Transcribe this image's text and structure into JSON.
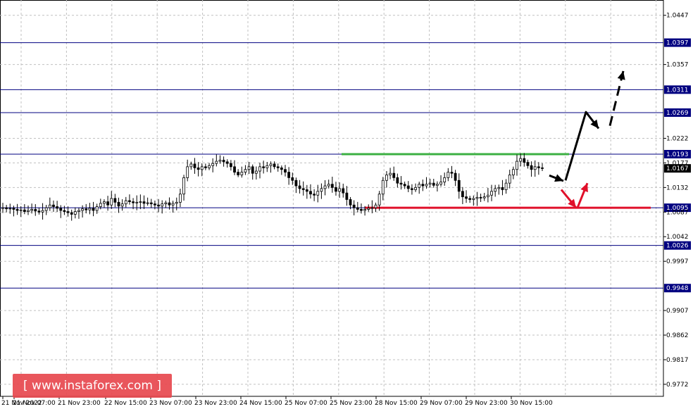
{
  "chart_data": {
    "type": "candlestick",
    "ylim": [
      0.975,
      1.0475
    ],
    "y_ticks": [
      "1.0447",
      "1.0357",
      "1.0222",
      "1.0177",
      "1.0132",
      "1.0087",
      "1.0042",
      "0.9997",
      "0.9907",
      "0.9862",
      "0.9817",
      "0.9772"
    ],
    "x_ticks": [
      "21 Nov 2022",
      "21 Nov 07:00",
      "21 Nov 23:00",
      "22 Nov 15:00",
      "23 Nov 07:00",
      "23 Nov 23:00",
      "24 Nov 15:00",
      "25 Nov 07:00",
      "25 Nov 23:00",
      "28 Nov 15:00",
      "29 Nov 07:00",
      "29 Nov 23:00",
      "30 Nov 15:00"
    ],
    "levels": [
      {
        "value": 1.0397,
        "label": "1.0397"
      },
      {
        "value": 1.0311,
        "label": "1.0311"
      },
      {
        "value": 1.0269,
        "label": "1.0269"
      },
      {
        "value": 1.0193,
        "label": "1.0193"
      },
      {
        "value": 1.0095,
        "label": "1.0095"
      },
      {
        "value": 1.0026,
        "label": "1.0026"
      },
      {
        "value": 0.9948,
        "label": "0.9948"
      }
    ],
    "current_price": {
      "value": 1.0167,
      "label": "1.0167"
    },
    "resistance_line": {
      "value": 1.0193,
      "color": "#3cb043"
    },
    "support_line": {
      "value": 1.0095,
      "color": "#e0102a"
    },
    "price_path": [
      1.0095,
      1.0093,
      1.0094,
      1.0092,
      1.009,
      1.0091,
      1.0088,
      1.009,
      1.0092,
      1.0089,
      1.0087,
      1.009,
      1.0095,
      1.01,
      1.0097,
      1.0094,
      1.009,
      1.0088,
      1.0086,
      1.0083,
      1.0088,
      1.009,
      1.0093,
      1.0091,
      1.0094,
      1.009,
      1.0097,
      1.0103,
      1.0106,
      1.01,
      1.0112,
      1.0105,
      1.0098,
      1.0102,
      1.0108,
      1.0106,
      1.0104,
      1.0105,
      1.0106,
      1.0103,
      1.0104,
      1.0102,
      1.01,
      1.0098,
      1.0102,
      1.0104,
      1.01,
      1.0103,
      1.0105,
      1.012,
      1.015,
      1.017,
      1.0175,
      1.0168,
      1.0165,
      1.017,
      1.0168,
      1.0172,
      1.0176,
      1.018,
      1.0182,
      1.0179,
      1.0176,
      1.017,
      1.016,
      1.0155,
      1.016,
      1.0165,
      1.017,
      1.0158,
      1.0162,
      1.017,
      1.0168,
      1.0172,
      1.0175,
      1.017,
      1.0168,
      1.0165,
      1.016,
      1.015,
      1.0145,
      1.0135,
      1.013,
      1.0128,
      1.0125,
      1.012,
      1.0118,
      1.0125,
      1.013,
      1.0135,
      1.0138,
      1.0132,
      1.0125,
      1.013,
      1.0122,
      1.011,
      1.01,
      1.0095,
      1.0092,
      1.009,
      1.0092,
      1.0094,
      1.0095,
      1.01,
      1.012,
      1.0145,
      1.0155,
      1.0158,
      1.015,
      1.014,
      1.0138,
      1.0135,
      1.013,
      1.0128,
      1.0132,
      1.0138,
      1.0135,
      1.0138,
      1.014,
      1.0136,
      1.0138,
      1.0142,
      1.015,
      1.016,
      1.0158,
      1.0145,
      1.0125,
      1.0115,
      1.0112,
      1.011,
      1.0112,
      1.0114,
      1.0113,
      1.0115,
      1.0118,
      1.0125,
      1.013,
      1.0132,
      1.0128,
      1.014,
      1.0155,
      1.0165,
      1.018,
      1.0185,
      1.0178,
      1.0172,
      1.0165,
      1.017,
      1.0168,
      1.0167
    ],
    "forecast_arrows": [
      {
        "color": "#000",
        "dashed": false,
        "points": [
          [
            1.0154,
            0
          ],
          [
            1.0144,
            1
          ]
        ]
      },
      {
        "color": "#e0102a",
        "dashed": false,
        "points": [
          [
            1.0128,
            0
          ],
          [
            1.0095,
            1
          ]
        ]
      },
      {
        "color": "#e0102a",
        "dashed": false,
        "points": [
          [
            1.0095,
            0
          ],
          [
            1.014,
            1
          ]
        ]
      },
      {
        "color": "#000",
        "dashed": false,
        "points": [
          [
            1.0145,
            0
          ],
          [
            1.027,
            1
          ],
          [
            1.024,
            2
          ]
        ]
      },
      {
        "color": "#000",
        "dashed": true,
        "points": [
          [
            1.0245,
            0
          ],
          [
            1.0345,
            1
          ]
        ]
      }
    ],
    "grid": true
  },
  "watermark": {
    "text": "[ www.instaforex.com ]"
  }
}
